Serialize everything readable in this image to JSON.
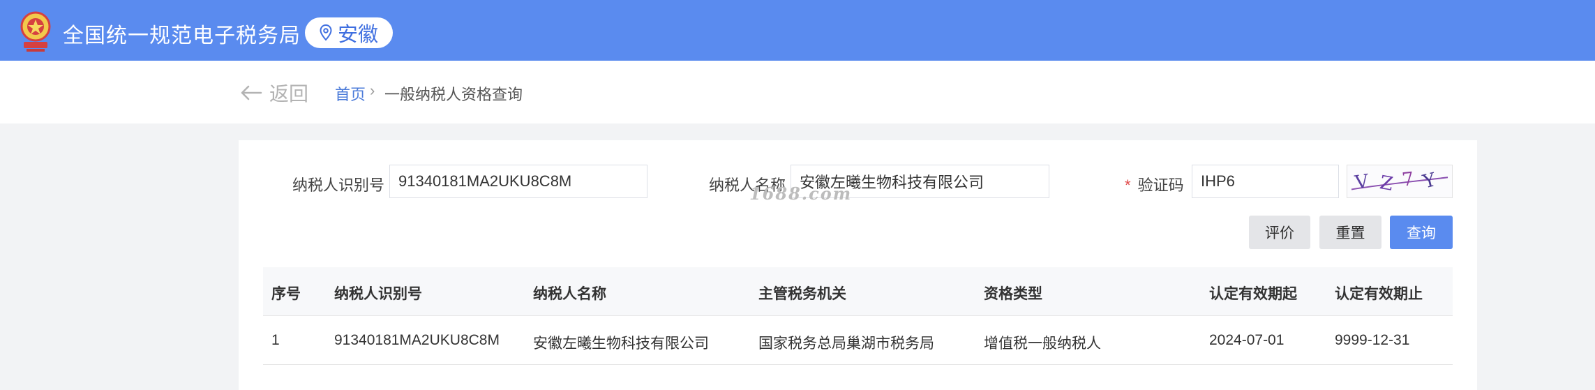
{
  "header": {
    "site_title": "全国统一规范电子税务局",
    "region": "安徽",
    "emblem_icon": "national-tax-emblem",
    "pin_icon": "location-pin-icon",
    "bg_color": "#5a8bef"
  },
  "nav": {
    "back_label": "返回",
    "breadcrumb_home": "首页",
    "breadcrumb_separator": "›",
    "breadcrumb_current": "一般纳税人资格查询"
  },
  "form": {
    "taxpayer_id_label": "纳税人识别号",
    "taxpayer_id_value": "91340181MA2UKU8C8M",
    "taxpayer_name_label": "纳税人名称",
    "taxpayer_name_value": "安徽左曦生物科技有限公司",
    "captcha_required_mark": "*",
    "captcha_label": "验证码",
    "captcha_value": "IHP6",
    "captcha_image_text": "VZ7Y",
    "buttons": {
      "evaluate": "评价",
      "reset": "重置",
      "query": "查询"
    }
  },
  "watermark": "1688.com",
  "table": {
    "columns": [
      "序号",
      "纳税人识别号",
      "纳税人名称",
      "主管税务机关",
      "资格类型",
      "认定有效期起",
      "认定有效期止"
    ],
    "rows": [
      [
        "1",
        "91340181MA2UKU8C8M",
        "安徽左曦生物科技有限公司",
        "国家税务总局巢湖市税务局",
        "增值税一般纳税人",
        "2024-07-01",
        "9999-12-31"
      ]
    ]
  }
}
